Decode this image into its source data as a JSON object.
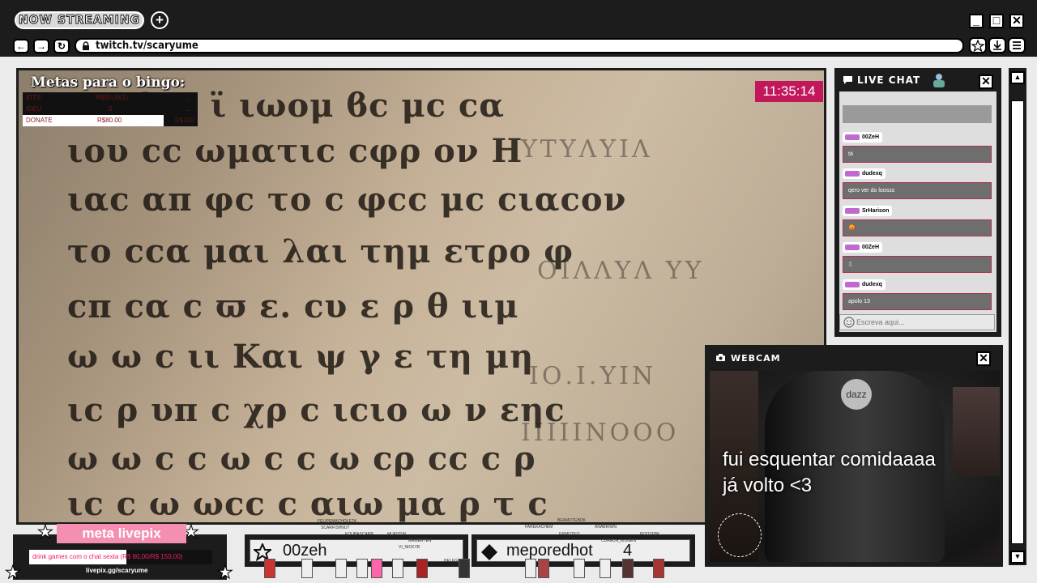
{
  "browser": {
    "tab_label": "NOW STREAMING",
    "new_tab_icon": "+",
    "url": "twitch.tv/scaryume",
    "window_controls": [
      "_",
      "□",
      "✕"
    ],
    "nav_buttons": [
      "←",
      "→",
      "↻"
    ],
    "toolbar_icons": [
      "star-icon",
      "download-icon",
      "menu-icon"
    ]
  },
  "stream": {
    "manuscript_lines": [
      "ιϲαϕιϲ ϊ ιωομ ϐϲ μϲ ϲα",
      "ιου ϲϲ ωματιϲ ϲφρ ον Η",
      "ιαϲ απ φϲ το ϲ φϲϲ μϲ ϲιαϲον",
      "το ϲϲα μαι λαι τημ ετρο φ",
      "ϲπ ϲα ϲ ϖ ε. ϲυ ε ρ θ ιιμ",
      "ω ω ϲ ιι Και ψ γ ε τη μη",
      "ιϲ ρ υπ ϲ χρ ϲ ιϲιο ω ν εηϲ",
      "ω ω ϲ ϲ ω ϲ ϲ ω ϲρ ϲϲ ϲ ρ",
      "ιϲ ϲ ω ωϲϲ ϲ αιω μα ρ τ ϲ"
    ],
    "bingo": {
      "title": "Metas para o bingo:",
      "rows": [
        {
          "c1": "IDTS",
          "c2": "R$50,00(1)",
          "c3": "..."
        },
        {
          "c1": "IDEU",
          "c2": "0",
          "c3": "..."
        },
        {
          "c1": "DONATE",
          "c2": "R$80.00",
          "c3": "R$100"
        }
      ]
    },
    "clock": "11:35:14"
  },
  "chat": {
    "title": "LIVE CHAT",
    "messages": [
      {
        "user": "00ZeH",
        "text": "tá"
      },
      {
        "user": "dudexq",
        "text": "qero ver do loosss"
      },
      {
        "user": "SrHarison",
        "text": "😡"
      },
      {
        "user": "00ZeH",
        "text": ":("
      },
      {
        "user": "dudexq",
        "text": "apolo 13"
      }
    ],
    "input_placeholder": "Escreva aqui..."
  },
  "webcam": {
    "title": "WEBCAM",
    "logo": "dazz",
    "caption_line1": "fui esquentar comidaaaa",
    "caption_line2": "já volto <3"
  },
  "livepix": {
    "title": "meta livepix",
    "goal_text": "drink games com o chat sexta (R$ 80,00/R$ 150,00)",
    "progress_fraction": 0.533,
    "url": "livepix.gg/scaryume"
  },
  "bottom": {
    "top_name": "00zeh",
    "second_name": "meporedhot",
    "second_count": "4",
    "viewer_labels": [
      "FELIPEMACHOLETA",
      "SCARFISHNUT",
      "KOUBASCARR",
      "MUKIDSN",
      "MAMERTEN",
      "VI_NICKYB",
      "HELEGHAN",
      "FAREKACHEM",
      "BEAMOTEBOK",
      "ERMOTEI7",
      "ANABRIWN",
      "CUREUN_MOGEN",
      "ROOTEBK"
    ]
  },
  "colors": {
    "accent": "#c2185b",
    "pink": "#f48fb1",
    "frame": "#1c1c1c"
  }
}
